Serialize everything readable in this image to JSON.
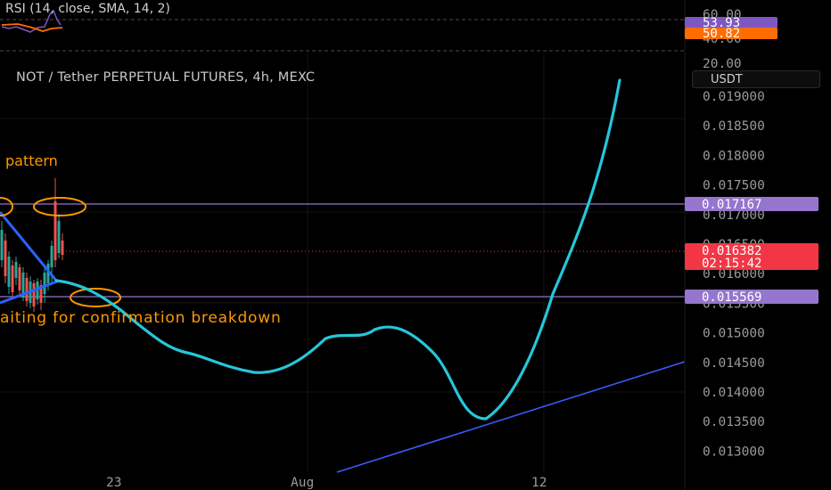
{
  "header": {
    "symbol_title": "NOT / Tether PERPETUAL FUTURES, 4h, MEXC",
    "currency_button": "USDT"
  },
  "rsi_panel": {
    "title": "RSI (14, close, SMA, 14, 2)",
    "scale_labels": [
      "60.00",
      "40.00",
      "20.00"
    ],
    "rsi_badge": "53.93",
    "sma_badge": "50.82",
    "colors": {
      "rsi": "#7e57c2",
      "sma": "#ff6d00"
    }
  },
  "price_axis": {
    "labels": [
      "0.019000",
      "0.018500",
      "0.018000",
      "0.017500",
      "0.017000",
      "0.016500",
      "0.016000",
      "0.015500",
      "0.015000",
      "0.014500",
      "0.014000",
      "0.013500",
      "0.013000"
    ]
  },
  "time_axis": {
    "labels": [
      "23",
      "Aug",
      "12"
    ]
  },
  "price_lines": [
    {
      "price": "0.017167",
      "color": "#9575cd"
    },
    {
      "price": "0.015569",
      "color": "#9575cd"
    }
  ],
  "current_price": {
    "price": "0.016382",
    "countdown": "02:15:42",
    "color": "#f23645"
  },
  "annotations": {
    "pattern_text": "pattern",
    "breakdown_text": "aiting for confirmation breakdown",
    "text_color": "#ff9800"
  },
  "colors": {
    "projection_curve": "#26c6da",
    "trendline": "#3d5afe",
    "wedge": "#2962ff",
    "circle": "#ff9800",
    "candle_up": "#26a69a",
    "candle_down": "#ef5350"
  }
}
